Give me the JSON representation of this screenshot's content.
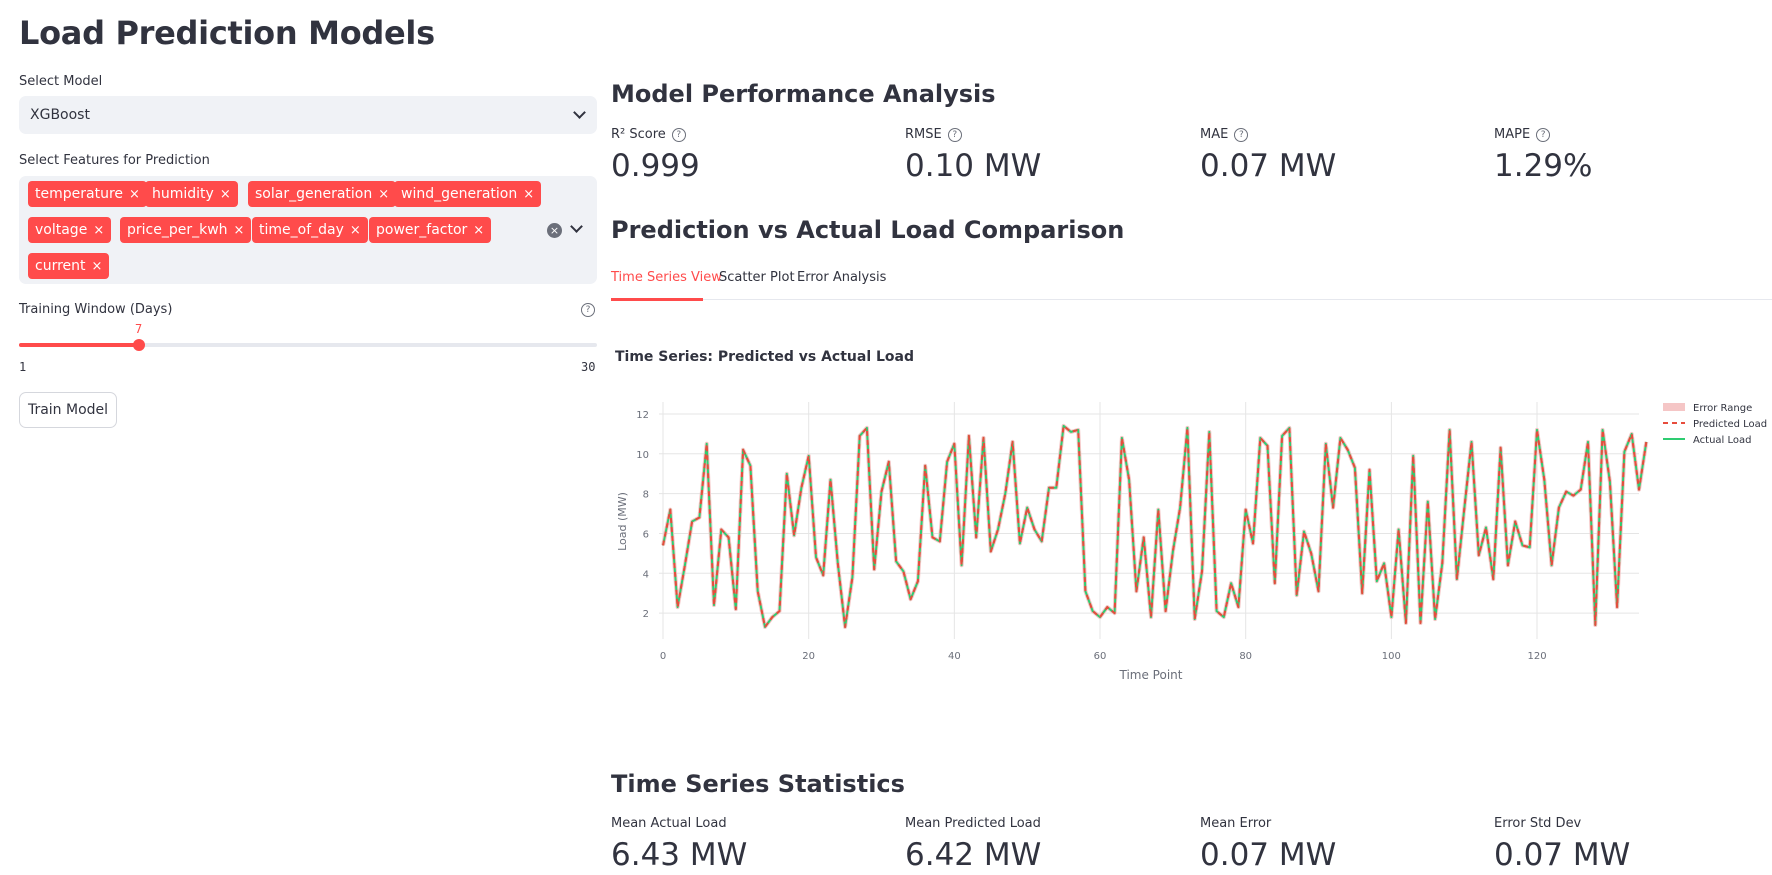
{
  "sidebar": {
    "title": "Load Prediction Models",
    "model_label": "Select Model",
    "model_value": "XGBoost",
    "features_label": "Select Features for Prediction",
    "features": [
      "temperature",
      "humidity",
      "solar_generation",
      "wind_generation",
      "voltage",
      "price_per_kwh",
      "time_of_day",
      "power_factor",
      "current"
    ],
    "remove_glyph": "×",
    "clear_glyph": "×",
    "window_label": "Training Window (Days)",
    "window_value": "7",
    "window_fraction": 0.2069,
    "window_min": "1",
    "window_max": "30",
    "train_button": "Train Model",
    "help_glyph": "?"
  },
  "performance": {
    "heading": "Model Performance Analysis",
    "metrics": [
      {
        "label": "R² Score",
        "value": "0.999"
      },
      {
        "label": "RMSE",
        "value": "0.10 MW"
      },
      {
        "label": "MAE",
        "value": "0.07 MW"
      },
      {
        "label": "MAPE",
        "value": "1.29%"
      }
    ]
  },
  "comparison": {
    "heading": "Prediction vs Actual Load Comparison",
    "tabs": [
      "Time Series View",
      "Scatter Plot",
      "Error Analysis"
    ],
    "active_tab": 0
  },
  "statistics": {
    "heading": "Time Series Statistics",
    "metrics": [
      {
        "label": "Mean Actual Load",
        "value": "6.43 MW"
      },
      {
        "label": "Mean Predicted Load",
        "value": "6.42 MW"
      },
      {
        "label": "Mean Error",
        "value": "0.07 MW"
      },
      {
        "label": "Error Std Dev",
        "value": "0.07 MW"
      }
    ]
  },
  "colors": {
    "accent": "#ff4b4b",
    "actual": "#2ecc71",
    "predicted": "#e74c3c",
    "error_range": "#f5c6c6"
  },
  "chart_data": {
    "type": "line",
    "title": "Time Series: Predicted vs Actual Load",
    "xlabel": "Time Point",
    "ylabel": "Load (MW)",
    "xlim": [
      0,
      134
    ],
    "ylim": [
      1.0,
      12.2
    ],
    "xticks": [
      0,
      20,
      40,
      60,
      80,
      100,
      120
    ],
    "yticks": [
      2,
      4,
      6,
      8,
      10,
      12
    ],
    "grid": true,
    "legend": "right",
    "series": [
      {
        "name": "Error Range",
        "style": "band"
      },
      {
        "name": "Predicted Load",
        "style": "dashed"
      },
      {
        "name": "Actual Load",
        "style": "solid",
        "values": [
          5.4,
          7.2,
          2.3,
          4.4,
          6.6,
          6.8,
          10.5,
          2.4,
          6.2,
          5.8,
          2.2,
          10.2,
          9.4,
          3.1,
          1.3,
          1.8,
          2.1,
          9.0,
          5.9,
          8.3,
          9.9,
          4.8,
          3.9,
          8.7,
          4.5,
          1.3,
          3.8,
          10.9,
          11.3,
          4.2,
          8.1,
          9.6,
          4.6,
          4.1,
          2.7,
          3.6,
          9.4,
          5.8,
          5.6,
          9.6,
          10.5,
          4.4,
          10.9,
          5.8,
          10.8,
          5.1,
          6.2,
          8.0,
          10.6,
          5.5,
          7.3,
          6.2,
          5.6,
          8.3,
          8.3,
          11.4,
          11.1,
          11.2,
          3.1,
          2.1,
          1.8,
          2.3,
          2.0,
          10.8,
          8.7,
          3.1,
          5.8,
          1.8,
          7.2,
          2.1,
          5.1,
          7.3,
          11.3,
          1.7,
          4.1,
          11.1,
          2.1,
          1.8,
          3.5,
          2.3,
          7.2,
          5.5,
          10.8,
          10.4,
          3.5,
          10.9,
          11.3,
          2.9,
          6.1,
          5.0,
          3.1,
          10.5,
          7.3,
          10.8,
          10.2,
          9.3,
          3.0,
          9.2,
          3.6,
          4.5,
          1.8,
          6.2,
          1.5,
          9.9,
          1.5,
          7.6,
          1.7,
          4.5,
          11.2,
          3.7,
          7.2,
          10.6,
          4.9,
          6.3,
          3.7,
          10.3,
          4.4,
          6.6,
          5.4,
          5.3,
          11.2,
          8.7,
          4.4,
          7.3,
          8.1,
          7.9,
          8.2,
          10.6,
          1.4,
          11.2,
          8.6,
          2.3,
          10.1,
          11.0,
          8.2,
          10.6
        ]
      }
    ]
  }
}
